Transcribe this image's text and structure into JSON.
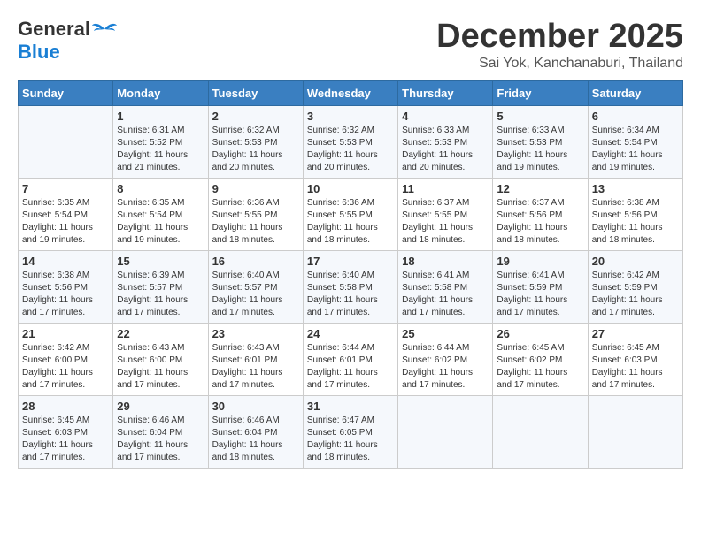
{
  "header": {
    "logo_general": "General",
    "logo_blue": "Blue",
    "month_title": "December 2025",
    "location": "Sai Yok, Kanchanaburi, Thailand"
  },
  "weekdays": [
    "Sunday",
    "Monday",
    "Tuesday",
    "Wednesday",
    "Thursday",
    "Friday",
    "Saturday"
  ],
  "weeks": [
    [
      {
        "day": "",
        "info": ""
      },
      {
        "day": "1",
        "info": "Sunrise: 6:31 AM\nSunset: 5:52 PM\nDaylight: 11 hours\nand 21 minutes."
      },
      {
        "day": "2",
        "info": "Sunrise: 6:32 AM\nSunset: 5:53 PM\nDaylight: 11 hours\nand 20 minutes."
      },
      {
        "day": "3",
        "info": "Sunrise: 6:32 AM\nSunset: 5:53 PM\nDaylight: 11 hours\nand 20 minutes."
      },
      {
        "day": "4",
        "info": "Sunrise: 6:33 AM\nSunset: 5:53 PM\nDaylight: 11 hours\nand 20 minutes."
      },
      {
        "day": "5",
        "info": "Sunrise: 6:33 AM\nSunset: 5:53 PM\nDaylight: 11 hours\nand 19 minutes."
      },
      {
        "day": "6",
        "info": "Sunrise: 6:34 AM\nSunset: 5:54 PM\nDaylight: 11 hours\nand 19 minutes."
      }
    ],
    [
      {
        "day": "7",
        "info": "Sunrise: 6:35 AM\nSunset: 5:54 PM\nDaylight: 11 hours\nand 19 minutes."
      },
      {
        "day": "8",
        "info": "Sunrise: 6:35 AM\nSunset: 5:54 PM\nDaylight: 11 hours\nand 19 minutes."
      },
      {
        "day": "9",
        "info": "Sunrise: 6:36 AM\nSunset: 5:55 PM\nDaylight: 11 hours\nand 18 minutes."
      },
      {
        "day": "10",
        "info": "Sunrise: 6:36 AM\nSunset: 5:55 PM\nDaylight: 11 hours\nand 18 minutes."
      },
      {
        "day": "11",
        "info": "Sunrise: 6:37 AM\nSunset: 5:55 PM\nDaylight: 11 hours\nand 18 minutes."
      },
      {
        "day": "12",
        "info": "Sunrise: 6:37 AM\nSunset: 5:56 PM\nDaylight: 11 hours\nand 18 minutes."
      },
      {
        "day": "13",
        "info": "Sunrise: 6:38 AM\nSunset: 5:56 PM\nDaylight: 11 hours\nand 18 minutes."
      }
    ],
    [
      {
        "day": "14",
        "info": "Sunrise: 6:38 AM\nSunset: 5:56 PM\nDaylight: 11 hours\nand 17 minutes."
      },
      {
        "day": "15",
        "info": "Sunrise: 6:39 AM\nSunset: 5:57 PM\nDaylight: 11 hours\nand 17 minutes."
      },
      {
        "day": "16",
        "info": "Sunrise: 6:40 AM\nSunset: 5:57 PM\nDaylight: 11 hours\nand 17 minutes."
      },
      {
        "day": "17",
        "info": "Sunrise: 6:40 AM\nSunset: 5:58 PM\nDaylight: 11 hours\nand 17 minutes."
      },
      {
        "day": "18",
        "info": "Sunrise: 6:41 AM\nSunset: 5:58 PM\nDaylight: 11 hours\nand 17 minutes."
      },
      {
        "day": "19",
        "info": "Sunrise: 6:41 AM\nSunset: 5:59 PM\nDaylight: 11 hours\nand 17 minutes."
      },
      {
        "day": "20",
        "info": "Sunrise: 6:42 AM\nSunset: 5:59 PM\nDaylight: 11 hours\nand 17 minutes."
      }
    ],
    [
      {
        "day": "21",
        "info": "Sunrise: 6:42 AM\nSunset: 6:00 PM\nDaylight: 11 hours\nand 17 minutes."
      },
      {
        "day": "22",
        "info": "Sunrise: 6:43 AM\nSunset: 6:00 PM\nDaylight: 11 hours\nand 17 minutes."
      },
      {
        "day": "23",
        "info": "Sunrise: 6:43 AM\nSunset: 6:01 PM\nDaylight: 11 hours\nand 17 minutes."
      },
      {
        "day": "24",
        "info": "Sunrise: 6:44 AM\nSunset: 6:01 PM\nDaylight: 11 hours\nand 17 minutes."
      },
      {
        "day": "25",
        "info": "Sunrise: 6:44 AM\nSunset: 6:02 PM\nDaylight: 11 hours\nand 17 minutes."
      },
      {
        "day": "26",
        "info": "Sunrise: 6:45 AM\nSunset: 6:02 PM\nDaylight: 11 hours\nand 17 minutes."
      },
      {
        "day": "27",
        "info": "Sunrise: 6:45 AM\nSunset: 6:03 PM\nDaylight: 11 hours\nand 17 minutes."
      }
    ],
    [
      {
        "day": "28",
        "info": "Sunrise: 6:45 AM\nSunset: 6:03 PM\nDaylight: 11 hours\nand 17 minutes."
      },
      {
        "day": "29",
        "info": "Sunrise: 6:46 AM\nSunset: 6:04 PM\nDaylight: 11 hours\nand 17 minutes."
      },
      {
        "day": "30",
        "info": "Sunrise: 6:46 AM\nSunset: 6:04 PM\nDaylight: 11 hours\nand 18 minutes."
      },
      {
        "day": "31",
        "info": "Sunrise: 6:47 AM\nSunset: 6:05 PM\nDaylight: 11 hours\nand 18 minutes."
      },
      {
        "day": "",
        "info": ""
      },
      {
        "day": "",
        "info": ""
      },
      {
        "day": "",
        "info": ""
      }
    ]
  ]
}
